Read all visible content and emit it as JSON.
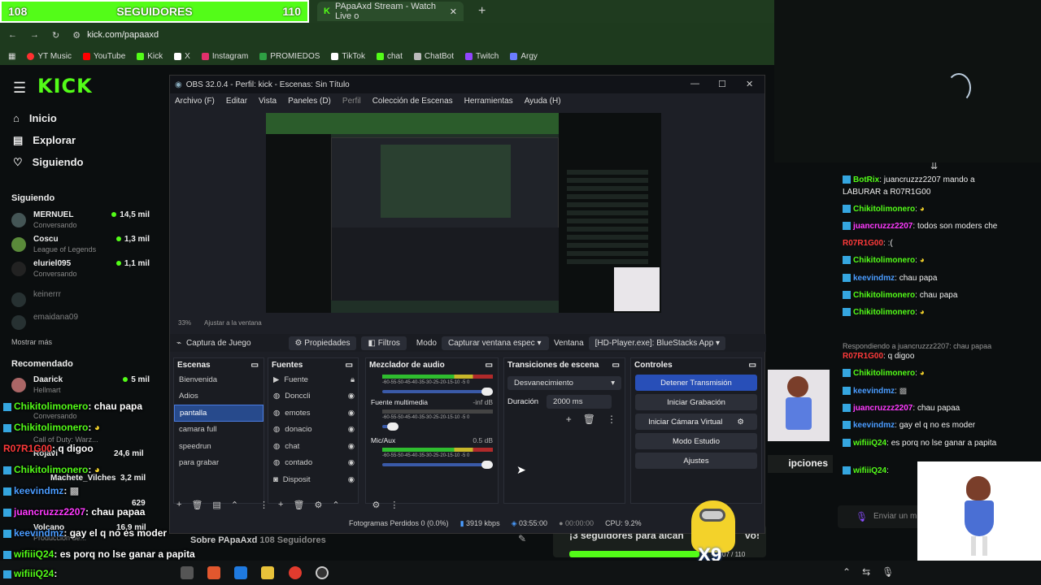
{
  "goal": {
    "current": "108",
    "label": "SEGUIDORES",
    "target": "110"
  },
  "browser": {
    "tab_title": "PApaAxd Stream - Watch Live o",
    "new_tab": "+",
    "url": "kick.com/papaaxd",
    "bookmarks": [
      {
        "label": "YT Music",
        "color": "#ff3030"
      },
      {
        "label": "YouTube",
        "color": "#ff0000"
      },
      {
        "label": "Kick",
        "color": "#53fc18"
      },
      {
        "label": "X",
        "color": "#ffffff"
      },
      {
        "label": "Instagram",
        "color": "#e1306c"
      },
      {
        "label": "PROMIEDOS",
        "color": "#2ea043"
      },
      {
        "label": "TikTok",
        "color": "#ffffff"
      },
      {
        "label": "chat",
        "color": "#53fc18"
      },
      {
        "label": "ChatBot",
        "color": "#bbbbbb"
      },
      {
        "label": "Twitch",
        "color": "#9146ff"
      },
      {
        "label": "Argy",
        "color": "#6a7cff"
      }
    ]
  },
  "kick": {
    "logo": "KICK",
    "nav": [
      "Inicio",
      "Explorar",
      "Siguiendo"
    ],
    "following_title": "Siguiendo",
    "following": [
      {
        "name": "MERNUEL",
        "sub": "Conversando",
        "count": "14,5 mil"
      },
      {
        "name": "Coscu",
        "sub": "League of Legends",
        "count": "1,3 mil"
      },
      {
        "name": "eluriel095",
        "sub": "Conversando",
        "count": "1,1 mil"
      },
      {
        "name": "keinerrr",
        "sub": "",
        "count": ""
      },
      {
        "name": "emaidana09",
        "sub": "",
        "count": ""
      }
    ],
    "show_more": "Mostrar más",
    "recommended_title": "Recomendado",
    "recommended": [
      {
        "name": "Daarick",
        "sub": "Hellmart",
        "count": "5 mil"
      },
      {
        "name": "",
        "sub": "Conversando",
        "count": ""
      },
      {
        "name": "",
        "sub": "Call of Duty: Warz...",
        "count": ""
      },
      {
        "name": "Rojavi",
        "sub": "",
        "count": "24,6 mil"
      },
      {
        "name": "Machete_Vilches",
        "sub": "",
        "count": "3,2 mil"
      },
      {
        "name": "",
        "sub": "",
        "count": "629"
      },
      {
        "name": "Volcano",
        "sub": "Producción de...",
        "count": "16,9 mil"
      }
    ],
    "about": "Sobre PApaAxd",
    "about_followers": "108 Seguidores",
    "goal_banner": "¡3 seguidores para alcan",
    "goal_banner_end": "vo!",
    "goal_progress_text": "07 / 110",
    "subs_label": "ipciones",
    "send_placeholder": "Enviar un m"
  },
  "obs": {
    "title": "OBS 32.0.4 - Perfil: kick - Escenas: Sin Título",
    "menu": [
      "Archivo (F)",
      "Editar",
      "Vista",
      "Paneles (D)",
      "Perfil",
      "Colección de Escenas",
      "Herramientas",
      "Ayuda (H)"
    ],
    "zoom": "33%",
    "fit": "Ajustar a la ventana",
    "source_name": "Captura de Juego",
    "properties": "Propiedades",
    "filters": "Filtros",
    "mode_label": "Modo",
    "mode_value": "Capturar ventana espec",
    "window_label": "Ventana",
    "window_value": "[HD-Player.exe]: BlueStacks App",
    "scenes_title": "Escenas",
    "scenes": [
      "Bienvenida",
      "Adios",
      "pantalla",
      "camara full",
      "speedrun",
      "para grabar"
    ],
    "sources_title": "Fuentes",
    "sources": [
      "Fuente",
      "Donccli",
      "emotes",
      "donacio",
      "chat",
      "contado",
      "Disposit"
    ],
    "mixer_title": "Mezclador de audio",
    "mixer": [
      {
        "name": "",
        "level": ""
      },
      {
        "name": "Fuente multimedia",
        "level": "-inf dB"
      },
      {
        "name": "Mic/Aux",
        "level": "0.5 dB"
      }
    ],
    "meter_scale": "-60-55-50-45-40-35-30-25-20-15-10 -5 0",
    "transitions_title": "Transiciones de escena",
    "transition_value": "Desvanecimiento",
    "duration_label": "Duración",
    "duration_value": "2000 ms",
    "controls_title": "Controles",
    "controls": [
      "Detener Transmisión",
      "Iniciar Grabación",
      "Iniciar Cámara Virtual",
      "Modo Estudio",
      "Ajustes"
    ],
    "status": {
      "dropped": "Fotogramas Perdidos 0 (0.0%)",
      "bitrate": "3919 kbps",
      "live_time": "03:55:00",
      "rec_time": "00:00:00",
      "cpu": "CPU: 9.2%"
    }
  },
  "chat": [
    {
      "user": "BotRix",
      "text": "juancruzzz2207 mando a",
      "color": "#53fc18"
    },
    {
      "user": "",
      "text": "LABURAR a R07R1G00",
      "color": ""
    },
    {
      "user": "Chikitolimonero",
      "text": "",
      "color": "#53fc18"
    },
    {
      "user": "juancruzzz2207",
      "text": "todos son moders che",
      "color": "#ff3aff"
    },
    {
      "user": "R07R1G00",
      "text": ":(",
      "color": "#ff3a3a"
    },
    {
      "user": "Chikitolimonero",
      "text": "",
      "color": "#53fc18"
    },
    {
      "user": "keevindmz",
      "text": "chau papa",
      "color": "#4a9cff"
    },
    {
      "user": "Chikitolimonero",
      "text": "chau papa",
      "color": "#53fc18"
    },
    {
      "user": "Chikitolimonero",
      "text": "",
      "color": "#53fc18"
    },
    {
      "user": "",
      "text": "Respondiendo a juancruzzz2207: chau papaa",
      "color": ""
    },
    {
      "user": "R07R1G00",
      "text": "q digoo",
      "color": "#ff3a3a"
    },
    {
      "user": "Chikitolimonero",
      "text": "",
      "color": "#53fc18"
    },
    {
      "user": "keevindmz",
      "text": "",
      "color": "#4a9cff"
    },
    {
      "user": "juancruzzz2207",
      "text": "chau papaa",
      "color": "#ff3aff"
    },
    {
      "user": "keevindmz",
      "text": "gay el q no es moder",
      "color": "#4a9cff"
    },
    {
      "user": "wifiiiQ24",
      "text": "es porq no lse ganar a papita",
      "color": "#53fc18"
    },
    {
      "user": "wifiiiQ24",
      "text": "",
      "color": "#53fc18"
    }
  ],
  "overlay_chat": [
    {
      "user": "Chikitolimonero",
      "text": ": chau papa",
      "color": "#53fc18"
    },
    {
      "user": "Chikitolimonero",
      "text": ":",
      "color": "#53fc18"
    },
    {
      "user": "R07R1G00",
      "text": ": q digoo",
      "color": "#ff3a3a"
    },
    {
      "user": "Chikitolimonero",
      "text": ":",
      "color": "#53fc18"
    },
    {
      "user": "keevindmz",
      "text": ":",
      "color": "#4a9cff"
    },
    {
      "user": "juancruzzz2207",
      "text": ": chau papaa",
      "color": "#ff3aff"
    },
    {
      "user": "keevindmz",
      "text": ": gay el q no es moder",
      "color": "#4a9cff"
    },
    {
      "user": "wifiiiQ24",
      "text": ": es porq no lse ganar a papita",
      "color": "#53fc18"
    },
    {
      "user": "wifiiiQ24",
      "text": ":",
      "color": "#53fc18"
    }
  ],
  "minion_multiplier": "X9"
}
